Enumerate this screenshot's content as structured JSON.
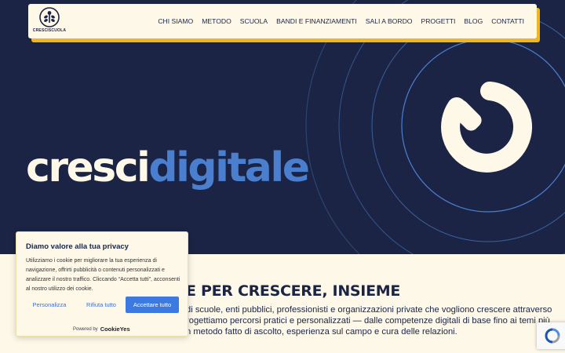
{
  "header": {
    "logo_text": "CRESCISCUOLA",
    "menu": [
      {
        "label": "CHI SIAMO"
      },
      {
        "label": "METODO"
      },
      {
        "label": "SCUOLA"
      },
      {
        "label": "BANDI E FINANZIAMENTI"
      },
      {
        "label": "SALI A BORDO"
      },
      {
        "label": "PROGETTI"
      },
      {
        "label": "BLOG"
      },
      {
        "label": "CONTATTI"
      }
    ]
  },
  "hero": {
    "brand_part1": "cresci",
    "brand_part2": "digitale",
    "icon": "power-icon"
  },
  "content": {
    "headline": "E PER CRESCERE, INSIEME",
    "lines": [
      "di scuole, enti pubblici, professionisti e organizzazioni private che vogliono crescere attraverso",
      "rogettiamo percorsi pratici e personalizzati — dalle competenze digitali di base fino ai temi più",
      "n metodo fatto di ascolto, esperienza sul campo e cura delle relazioni."
    ]
  },
  "cookie_banner": {
    "title": "Diamo valore alla tua privacy",
    "text": "Utilizziamo i cookie per migliorare la tua esperienza di navigazione, offrirti pubblicità o contenuti personalizzati e analizzare il nostro traffico. Cliccando “Accetta tutti”, acconsenti al nostro utilizzo dei cookie.",
    "customize_label": "Personalizza",
    "reject_label": "Rifiuta tutto",
    "accept_label": "Accettare tutto",
    "powered_by": "Powered by",
    "powered_brand": "CookieYes"
  },
  "colors": {
    "navy": "#1c2445",
    "cream": "#fdf8e8",
    "accent_blue": "#4a7fcf",
    "yellow": "#f2b51c",
    "button_blue": "#3c79e0"
  },
  "icons": [
    "logo-plant-icon",
    "power-icon",
    "cookieyes-logo-icon",
    "recaptcha-icon"
  ]
}
